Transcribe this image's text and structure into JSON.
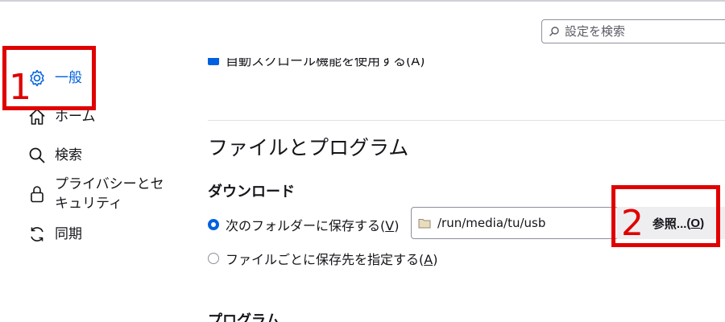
{
  "search": {
    "placeholder": "設定を検索"
  },
  "sidebar": {
    "items": [
      {
        "label": "一般",
        "active": true,
        "icon": "gear-icon"
      },
      {
        "label": "ホーム",
        "icon": "home-icon"
      },
      {
        "label": "検索",
        "icon": "search-icon"
      },
      {
        "label": "プライバシーとセキュリティ",
        "icon": "lock-icon"
      },
      {
        "label": "同期",
        "icon": "sync-icon"
      }
    ]
  },
  "annotations": {
    "first": "1",
    "second": "2"
  },
  "main": {
    "clipped_checkbox_label": "自動スクロール機能を使用する(A)",
    "section_title": "ファイルとプログラム",
    "downloads": {
      "heading": "ダウンロード",
      "save_to_label": "次のフォルダーに保存する",
      "save_to_key": "V",
      "folder_path": "/run/media/tu/usb",
      "browse_label": "参照...",
      "browse_key": "O",
      "always_ask_label": "ファイルごとに保存先を指定する",
      "always_ask_key": "A"
    },
    "programs_heading": "プログラム"
  },
  "colors": {
    "accent": "#0061e0",
    "annotation": "#e00000"
  }
}
